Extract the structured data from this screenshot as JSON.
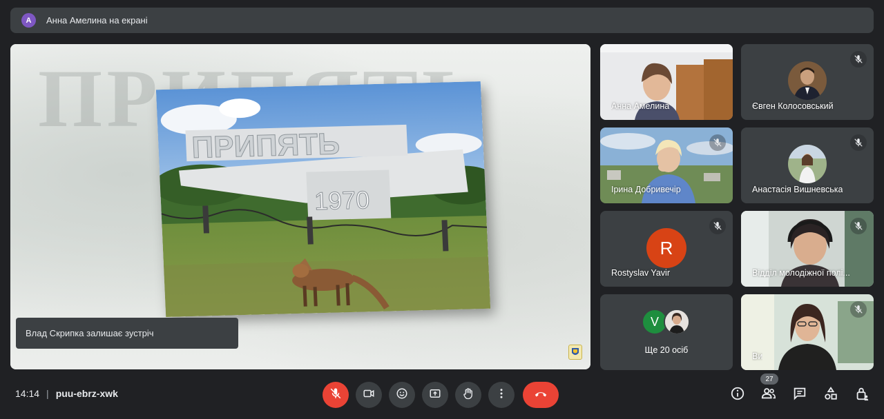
{
  "presenting": {
    "avatar_letter": "А",
    "text": "Анна Амелина на екрані"
  },
  "stage": {
    "sign_word": "ПРИПЯТЬ",
    "sign_year": "1970",
    "toast": "Влад Скрипка залишає зустріч"
  },
  "participants": [
    {
      "name": "Анна Амелина",
      "type": "video",
      "muted": false
    },
    {
      "name": "Євген Колосовський",
      "type": "photo",
      "muted": true
    },
    {
      "name": "Ірина Добривечір",
      "type": "video",
      "muted": true
    },
    {
      "name": "Анастасія Вишневська",
      "type": "photo",
      "muted": true
    },
    {
      "name": "Rostyslav Yavir",
      "type": "letter",
      "letter": "R",
      "muted": true
    },
    {
      "name": "Відділ молодіжної полі...",
      "type": "video",
      "muted": true
    },
    {
      "name": "Ще 20 осіб",
      "type": "more",
      "letter": "V"
    },
    {
      "name": "Ви",
      "type": "video",
      "muted": true
    }
  ],
  "meeting": {
    "time": "14:14",
    "separator": "|",
    "code": "puu-ebrz-xwk"
  },
  "people_count": "27",
  "colors": {
    "background": "#202124",
    "surface": "#3c4043",
    "danger": "#ea4335",
    "avatar_purple": "#7e57c2",
    "avatar_orange": "#d84315",
    "avatar_green": "#1e8e3e"
  }
}
